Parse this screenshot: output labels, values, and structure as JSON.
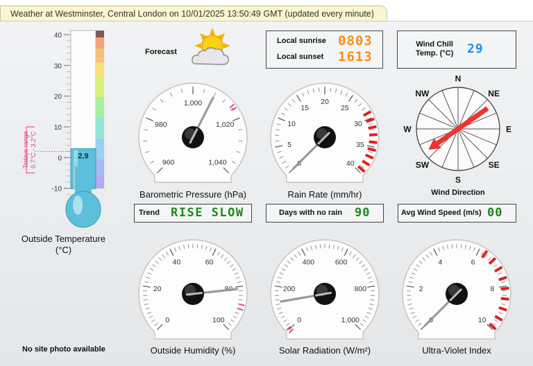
{
  "title": "Weather at Westminster, Central London on 10/01/2025 13:50:49 GMT (updated every minute)",
  "forecast": {
    "label": "Forecast",
    "icon": "partly-cloudy-sun-icon"
  },
  "sun": {
    "sunrise_label": "Local sunrise",
    "sunrise_value": "0803",
    "sunset_label": "Local sunset",
    "sunset_value": "1613"
  },
  "wind_chill": {
    "label_line1": "Wind Chill",
    "label_line2": "Temp. (°C)",
    "value": "29"
  },
  "temperature": {
    "value": 2.9,
    "value_label": "2.9",
    "ticks": [
      "40",
      "30",
      "20",
      "10",
      "0",
      "-10"
    ],
    "range_label_line1": "Todays range",
    "range_label_line2": "0.7°C - 3.2°C",
    "caption_line1": "Outside Temperature",
    "caption_line2": "(°C)"
  },
  "pressure": {
    "value": 1010,
    "ticks": [
      "960",
      "980",
      "1,000",
      "1,020",
      "1,040"
    ],
    "caption": "Barometric Pressure (hPa)"
  },
  "rain_rate": {
    "value": 0,
    "ticks": [
      "0",
      "5",
      "10",
      "15",
      "20",
      "25",
      "30",
      "35",
      "40"
    ],
    "caption": "Rain Rate (mm/hr)"
  },
  "wind_direction": {
    "value_degrees": 235,
    "compass": [
      "N",
      "NE",
      "E",
      "SE",
      "S",
      "SW",
      "W",
      "NW"
    ],
    "caption": "Wind Direction"
  },
  "trend": {
    "label": "Trend",
    "value": "RISE SLOW"
  },
  "days_no_rain": {
    "label": "Days with no rain",
    "value": "90"
  },
  "avg_wind": {
    "label": "Avg Wind Speed (m/s)",
    "value": "00"
  },
  "humidity": {
    "value": 81,
    "ticks": [
      "0",
      "20",
      "40",
      "60",
      "80",
      "100"
    ],
    "caption": "Outside Humidity (%)"
  },
  "solar": {
    "value": 130,
    "ticks": [
      "0",
      "200",
      "400",
      "600",
      "800",
      "1,000"
    ],
    "caption": "Solar Radiation (W/m²)"
  },
  "uv": {
    "value": 0,
    "ticks": [
      "0",
      "2",
      "4",
      "6",
      "8",
      "10"
    ],
    "caption": "Ultra-Violet Index"
  },
  "site_photo": "No site photo available",
  "colors": {
    "lcd_orange": "#ff8c1a",
    "lcd_green": "#1a8a1a",
    "lcd_blue": "#1e90ff",
    "needle": "#999999",
    "wind_arrow": "#ee3333",
    "range_pink": "#e0408a"
  }
}
